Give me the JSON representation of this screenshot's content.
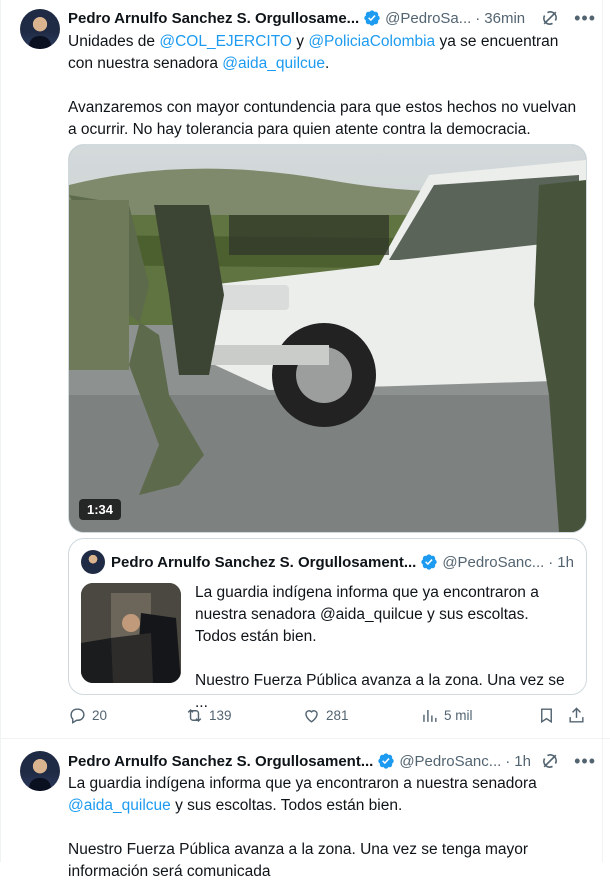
{
  "tweet1": {
    "author_name": "Pedro Arnulfo Sanchez S. Orgullosame...",
    "author_handle": "@PedroSa...",
    "dot": "·",
    "time": "36min",
    "grok_icon": "grok-icon",
    "more_label": "•••",
    "line1_a": "Unidades de ",
    "mention_1": "@COL_EJERCITO",
    "line1_b": " y ",
    "mention_2": "@PoliciaColombia",
    "line1_c": " ya se encuentran con nuestra senadora ",
    "mention_3": "@aida_quilcue",
    "line1_d": ".",
    "paragraph2": "Avanzaremos con mayor contundencia para que estos hechos no vuelvan a ocurrir. No hay tolerancia para quien atente contra la democracia.",
    "video_duration": "1:34"
  },
  "quote": {
    "author_name": "Pedro Arnulfo Sanchez S. Orgullosament...",
    "author_handle": "@PedroSanc...",
    "dot": "·",
    "time": "1h",
    "paragraph1": "La guardia indígena informa que ya encontraron a nuestra senadora @aida_quilcue y sus escoltas. Todos están bien.",
    "paragraph2": "Nuestro Fuerza Pública avanza a la zona. Una vez se ..."
  },
  "actions": {
    "replies": "20",
    "reposts": "139",
    "likes": "281",
    "views": "5 mil"
  },
  "tweet2": {
    "author_name": "Pedro Arnulfo Sanchez S. Orgullosament...",
    "author_handle": "@PedroSanc...",
    "dot": "·",
    "time": "1h",
    "line1": "La guardia indígena informa que ya encontraron a nuestra senadora ",
    "mention": "@aida_quilcue",
    "line1_end": " y sus escoltas. Todos están bien.",
    "paragraph2": "Nuestro Fuerza Pública avanza a la zona. Una vez se tenga mayor información será comunicada"
  },
  "colors": {
    "accent": "#1d9bf0",
    "secondary_text": "#536471",
    "border": "#cfd9de"
  }
}
